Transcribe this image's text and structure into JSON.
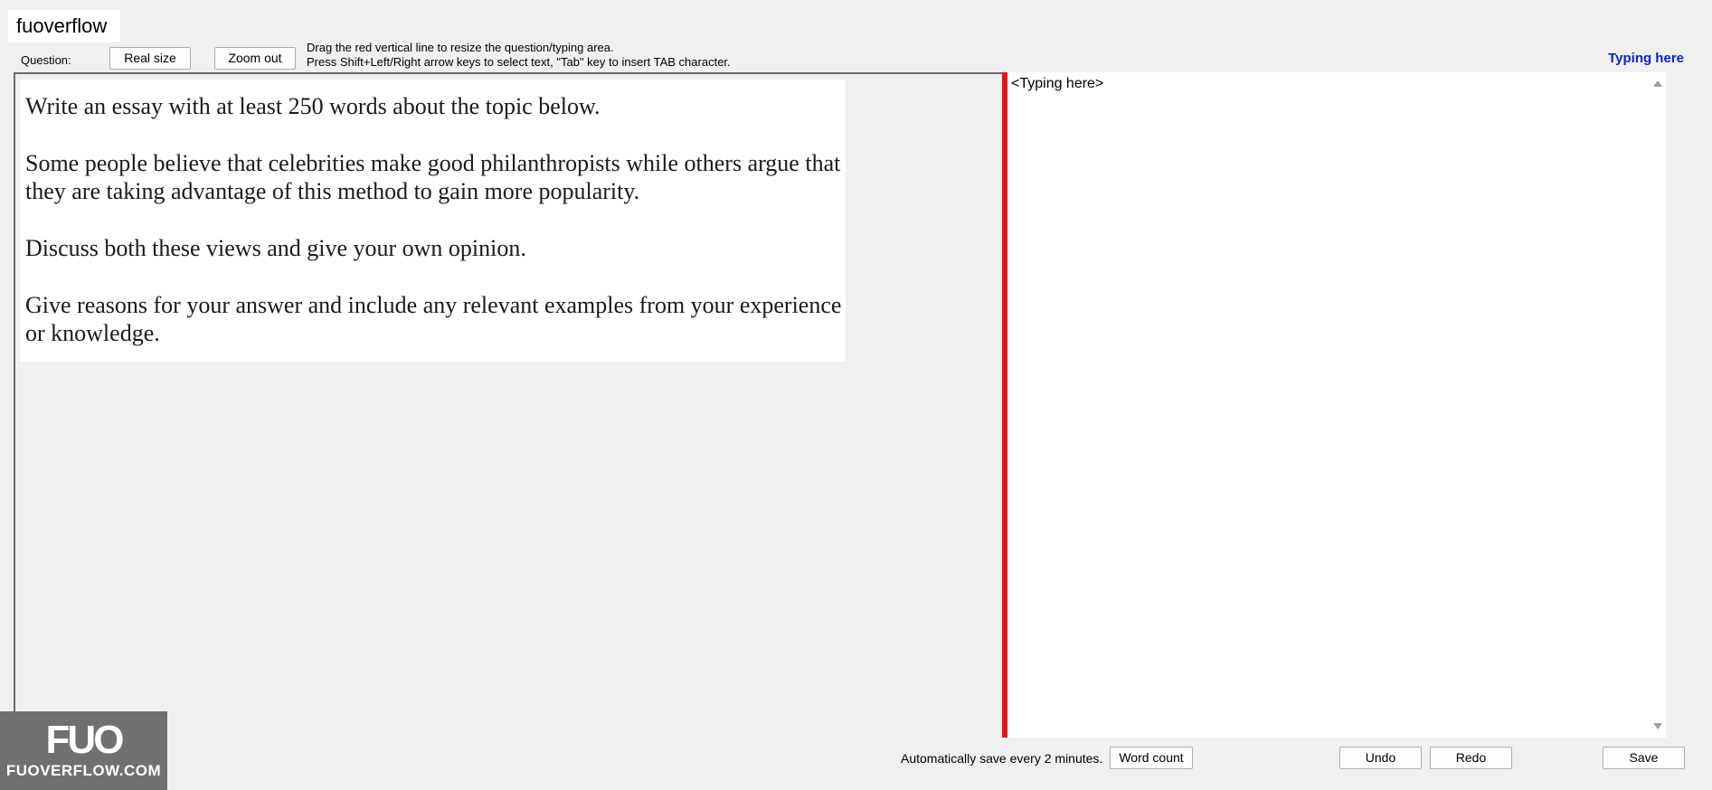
{
  "app": {
    "title": "fuoverflow"
  },
  "header": {
    "question_label": "Question:",
    "real_size_label": "Real size",
    "zoom_out_label": "Zoom out",
    "instruction_line1": "Drag the red vertical line to resize the question/typing area.",
    "instruction_line2": "Press Shift+Left/Right arrow keys to select text, \"Tab\" key to insert TAB character.",
    "typing_here_label": "Typing here"
  },
  "question": {
    "paragraphs": [
      "Write an essay with at least 250 words about the topic below.",
      "Some people believe that celebrities make good philanthropists while others argue that they are taking advantage of this method to gain more popularity.",
      "Discuss both these views and give your own opinion.",
      "Give reasons for your answer and include any relevant examples from your experience or knowledge."
    ]
  },
  "typing": {
    "placeholder": "<Typing here>",
    "value": ""
  },
  "footer": {
    "autosave_text": "Automatically save every 2 minutes.",
    "word_count_label": "Word count",
    "undo_label": "Undo",
    "redo_label": "Redo",
    "save_label": "Save"
  },
  "watermark": {
    "logo": "FUO",
    "text": "FUOVERFLOW.COM"
  },
  "colors": {
    "splitter": "#e3141b",
    "typing_label": "#0b1ed8"
  }
}
